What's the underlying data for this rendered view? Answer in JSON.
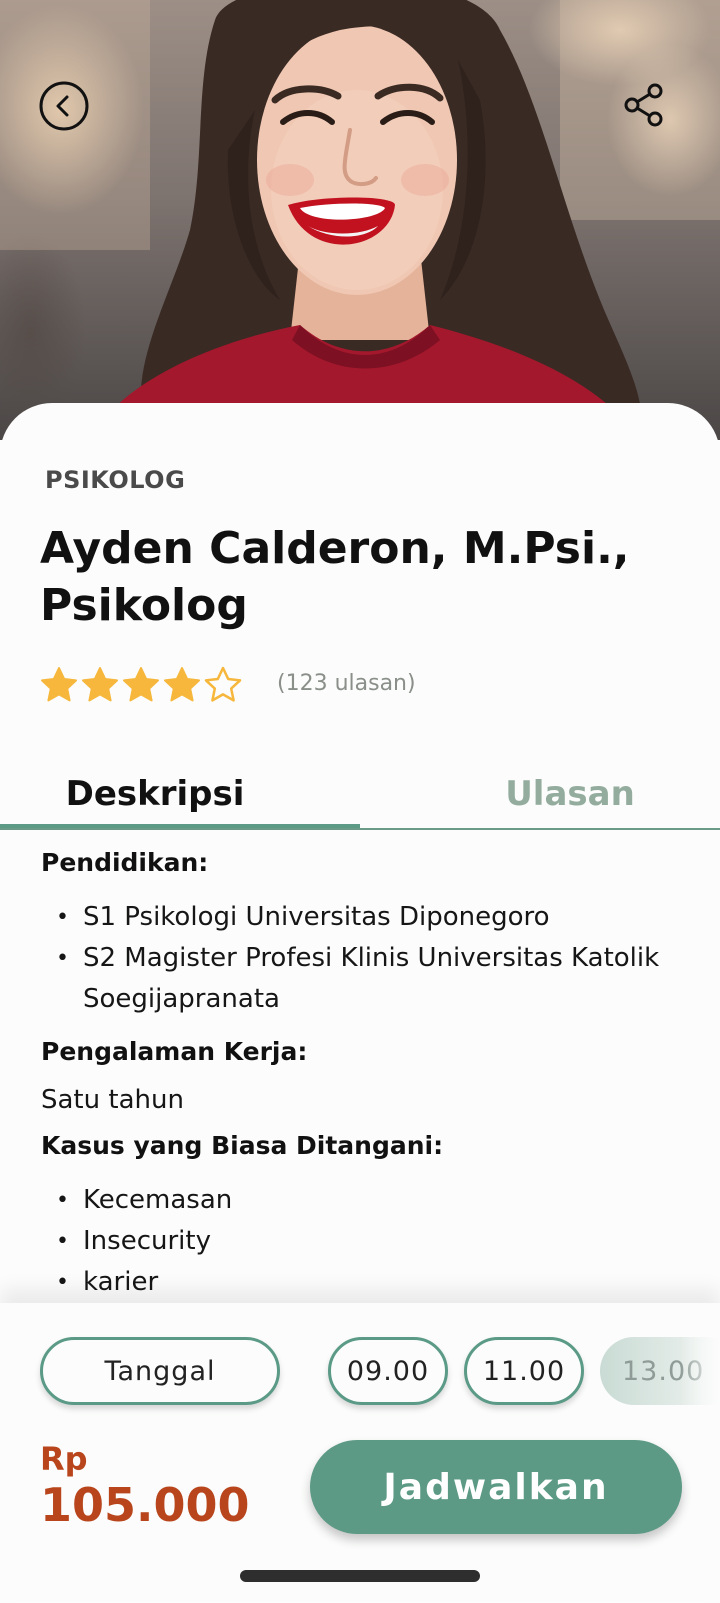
{
  "hero": {
    "back_icon": "chevron-left-circle-icon",
    "share_icon": "share-icon"
  },
  "profile": {
    "category": "PSIKOLOG",
    "name": "Ayden Calderon, M.Psi., Psikolog",
    "rating": 4,
    "rating_max": 5,
    "reviews": "(123 ulasan)",
    "star_color": "#f6b73c"
  },
  "tabs": [
    {
      "label": "Deskripsi",
      "active": true
    },
    {
      "label": "Ulasan",
      "active": false
    }
  ],
  "description": {
    "education_heading": "Pendidikan:",
    "education": [
      "S1 Psikologi Universitas Diponegoro",
      "S2 Magister Profesi Klinis Universitas Katolik Soegijapranata"
    ],
    "experience_heading": "Pengalaman Kerja:",
    "experience": "Satu tahun",
    "cases_heading": "Kasus yang Biasa Ditangani:",
    "cases": [
      "Kecemasan",
      "Insecurity",
      "karier"
    ]
  },
  "booking": {
    "date_label": "Tanggal",
    "times": [
      "09.00",
      "11.00",
      "13.00"
    ],
    "currency": "Rp",
    "price": "105.000",
    "schedule_label": "Jadwalkan"
  },
  "colors": {
    "accent": "#5c9a86",
    "price": "#b8451c",
    "muted_tab": "#93ac9e"
  }
}
